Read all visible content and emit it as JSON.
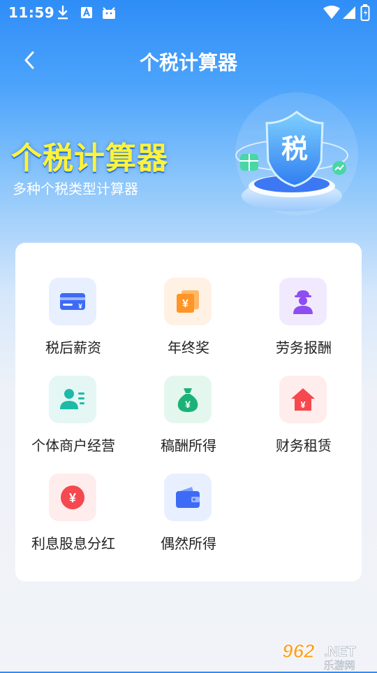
{
  "status_bar": {
    "time": "11:59",
    "icons": [
      "download-icon",
      "a-keyboard-icon",
      "android-icon",
      "wifi-icon",
      "signal-icon",
      "battery-icon"
    ]
  },
  "nav": {
    "title": "个税计算器",
    "back_icon": "chevron-left-icon"
  },
  "hero": {
    "title": "个税计算器",
    "subtitle": "多种个税类型计算器",
    "shield_text": "税"
  },
  "calculators": [
    {
      "label": "税后薪资",
      "icon": "card-icon",
      "tint": "#e8f0ff",
      "color": "#3d6bf5"
    },
    {
      "label": "年终奖",
      "icon": "money-stack-icon",
      "tint": "#fff1e3",
      "color": "#ff9526"
    },
    {
      "label": "劳务报酬",
      "icon": "worker-icon",
      "tint": "#f1eaff",
      "color": "#8c4df2"
    },
    {
      "label": "个体商户经营",
      "icon": "person-list-icon",
      "tint": "#e4f7f4",
      "color": "#1dbba7"
    },
    {
      "label": "稿酬所得",
      "icon": "money-bag-icon",
      "tint": "#e4f7ee",
      "color": "#1cb277"
    },
    {
      "label": "财务租赁",
      "icon": "house-icon",
      "tint": "#ffecec",
      "color": "#f6484f"
    },
    {
      "label": "利息股息分红",
      "icon": "coin-icon",
      "tint": "#ffecec",
      "color": "#f6484f"
    },
    {
      "label": "偶然所得",
      "icon": "wallet-icon",
      "tint": "#e8f0ff",
      "color": "#3d6bf5"
    }
  ],
  "watermark": {
    "number": "962",
    "suffix": ".NET",
    "text": "乐游网"
  }
}
